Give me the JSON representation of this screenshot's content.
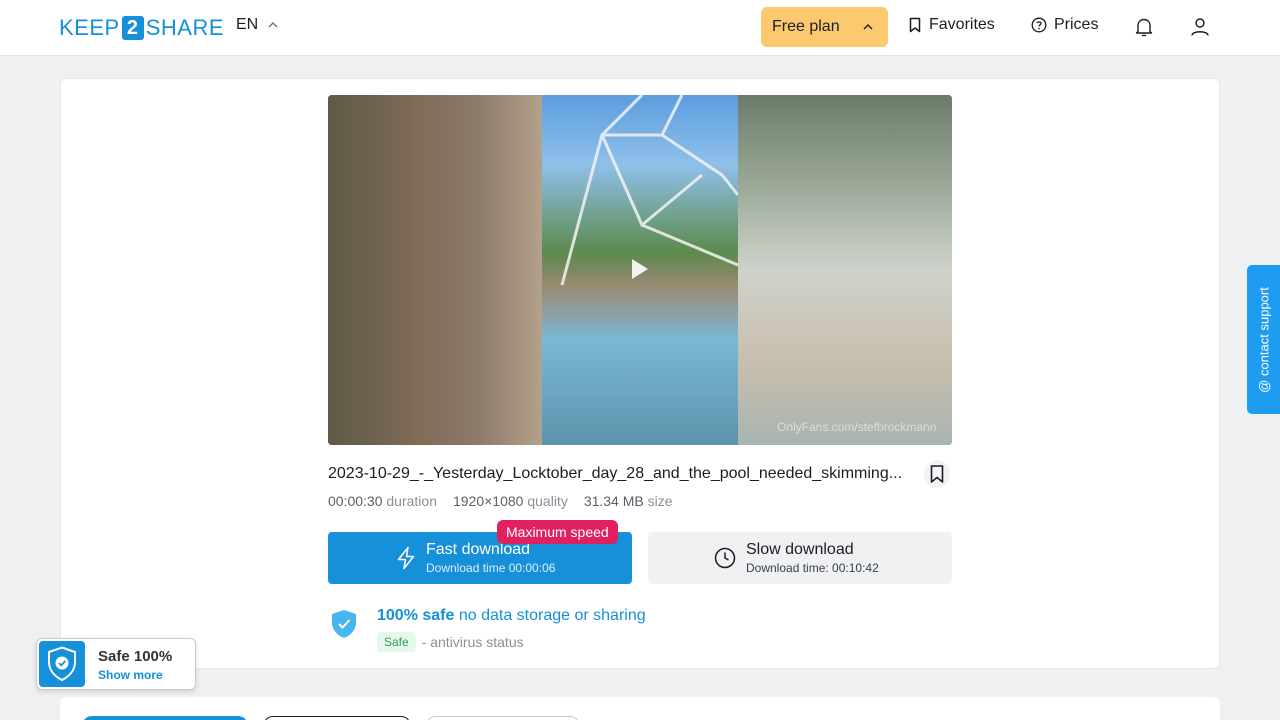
{
  "header": {
    "logo_left": "KEEP",
    "logo_mid": "2",
    "logo_right": "SHARE",
    "language": "EN",
    "free_plan": "Free plan",
    "favorites": "Favorites",
    "prices": "Prices"
  },
  "video": {
    "watermark": "OnlyFans.com/stefbrockmann"
  },
  "file": {
    "name": "2023-10-29_-_Yesterday_Locktober_day_28_and_the_pool_needed_skimming...",
    "duration_value": "00:00:30",
    "duration_label": "duration",
    "quality_value": "1920×1080",
    "quality_label": "quality",
    "size_value": "31.34 MB",
    "size_label": "size"
  },
  "download": {
    "badge": "Maximum speed",
    "fast_label": "Fast download",
    "fast_time": "Download time 00:00:06",
    "slow_label": "Slow download",
    "slow_time": "Download time: 00:10:42"
  },
  "safety": {
    "headline_strong": "100% safe",
    "headline_rest": "no data storage or sharing",
    "status_pill": "Safe",
    "status_text": "- antivirus status"
  },
  "contact_support": "@ contact support",
  "safe_widget": {
    "title": "Safe 100%",
    "link": "Show more"
  },
  "colors": {
    "primary": "#1590d9",
    "free_plan_bg": "#fcc96e",
    "badge_red": "#e02160"
  }
}
